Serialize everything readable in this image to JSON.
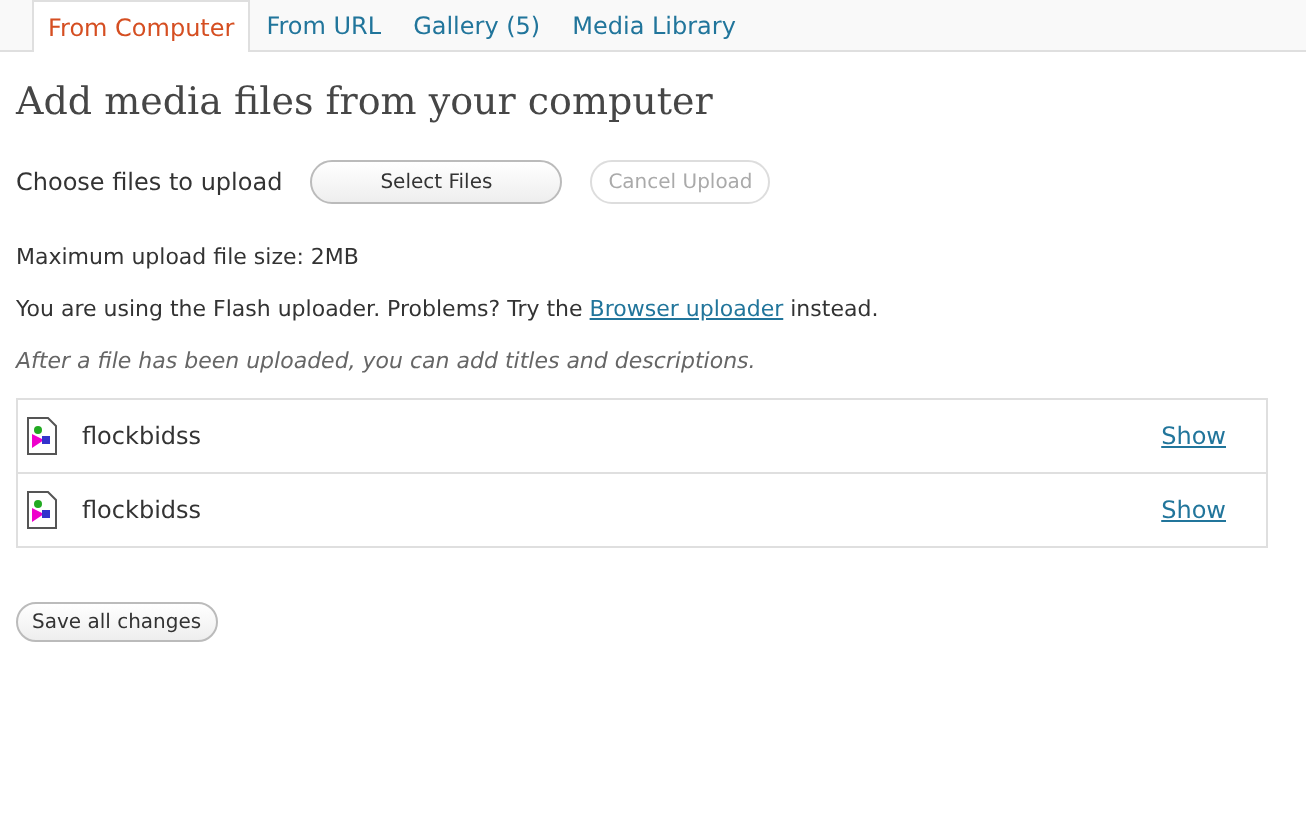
{
  "tabs": [
    {
      "label": "From Computer",
      "selected": true
    },
    {
      "label": "From URL",
      "selected": false
    },
    {
      "label": "Gallery (5)",
      "selected": false
    },
    {
      "label": "Media Library",
      "selected": false
    }
  ],
  "heading": "Add media files from your computer",
  "upload": {
    "label": "Choose files to upload",
    "buttons": [
      {
        "label": "Select Files",
        "disabled": false
      },
      {
        "label": "Cancel Upload",
        "disabled": true
      }
    ]
  },
  "max_size": "Maximum upload file size: 2MB",
  "flash_note": {
    "before": "You are using the Flash uploader. Problems? Try the",
    "link": "Browser uploader",
    "after": "instead."
  },
  "hint": "After a file has been uploaded, you can add titles and descriptions.",
  "files": [
    {
      "name": "flockbidss",
      "action": "Show"
    },
    {
      "name": "flockbidss",
      "action": "Show"
    }
  ],
  "save_button": "Save all changes"
}
